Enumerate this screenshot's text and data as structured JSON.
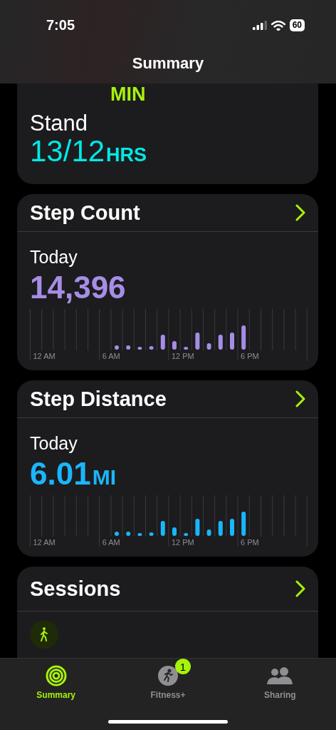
{
  "status_bar": {
    "time": "7:05",
    "battery": "60"
  },
  "nav": {
    "title": "Summary"
  },
  "activity": [
    {
      "kind": "exercise",
      "unit": "MIN"
    },
    {
      "kind": "stand",
      "label": "Stand",
      "value": "13/12",
      "unit": "HRS"
    }
  ],
  "cards": [
    {
      "kind": "steps",
      "title": "Step Count",
      "period": "Today",
      "value": "14,396",
      "axis_labels": [
        "12 AM",
        "6 AM",
        "12 PM",
        "6 PM"
      ]
    },
    {
      "kind": "distance",
      "title": "Step Distance",
      "period": "Today",
      "value": "6.01",
      "unit": "MI",
      "axis_labels": [
        "12 AM",
        "6 AM",
        "12 PM",
        "6 PM"
      ]
    }
  ],
  "sessions": {
    "title": "Sessions",
    "items": [
      {
        "kind": "walk"
      }
    ]
  },
  "tab_bar": [
    {
      "kind": "rings",
      "label": "Summary",
      "selected": true
    },
    {
      "kind": "fitness",
      "label": "Fitness+",
      "selected": false,
      "badge": "1"
    },
    {
      "kind": "sharing",
      "label": "Sharing",
      "selected": false
    }
  ]
}
